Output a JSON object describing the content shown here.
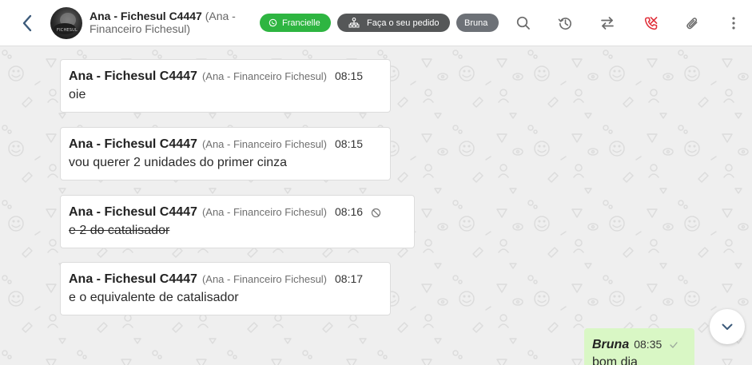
{
  "header": {
    "contact_name": "Ana - Fichesul C4447",
    "contact_sub_inline": "(Ana -",
    "contact_sub_line2": "Financeiro Fichesul)",
    "avatar_text": "FICHESUL",
    "tags": {
      "whatsapp_label": "Francielle",
      "order_label": "Faça o seu pedido",
      "agent_label": "Bruna"
    },
    "colors": {
      "whatsapp_tag": "#2eb541",
      "order_tag": "#555758",
      "agent_tag": "#6d7177",
      "end_call_icon": "#e0303a"
    },
    "icons": [
      "back-arrow-icon",
      "whatsapp-icon",
      "org-chart-icon",
      "search-icon",
      "history-icon",
      "transfer-icon",
      "end-call-icon",
      "attach-icon",
      "more-vertical-icon"
    ]
  },
  "messages": [
    {
      "sender": "Ana - Fichesul C4447",
      "sender_sub": "(Ana - Financeiro Fichesul)",
      "time": "08:15",
      "text": "oie"
    },
    {
      "sender": "Ana - Fichesul C4447",
      "sender_sub": "(Ana - Financeiro Fichesul)",
      "time": "08:15",
      "text": "vou querer 2 unidades do primer cinza"
    },
    {
      "sender": "Ana - Fichesul C4447",
      "sender_sub": "(Ana - Financeiro Fichesul)",
      "time": "08:16",
      "text": "e 2 do catalisador",
      "deleted": true
    },
    {
      "sender": "Ana - Fichesul C4447",
      "sender_sub": "(Ana - Financeiro Fichesul)",
      "time": "08:17",
      "text": "e o equivalente de catalisador"
    }
  ],
  "own_message": {
    "sender": "Bruna",
    "time": "08:35",
    "text": "bom dia"
  },
  "colors": {
    "chat_background": "#efefef",
    "own_bubble": "#d9f7c5",
    "incoming_bubble": "#ffffff"
  }
}
